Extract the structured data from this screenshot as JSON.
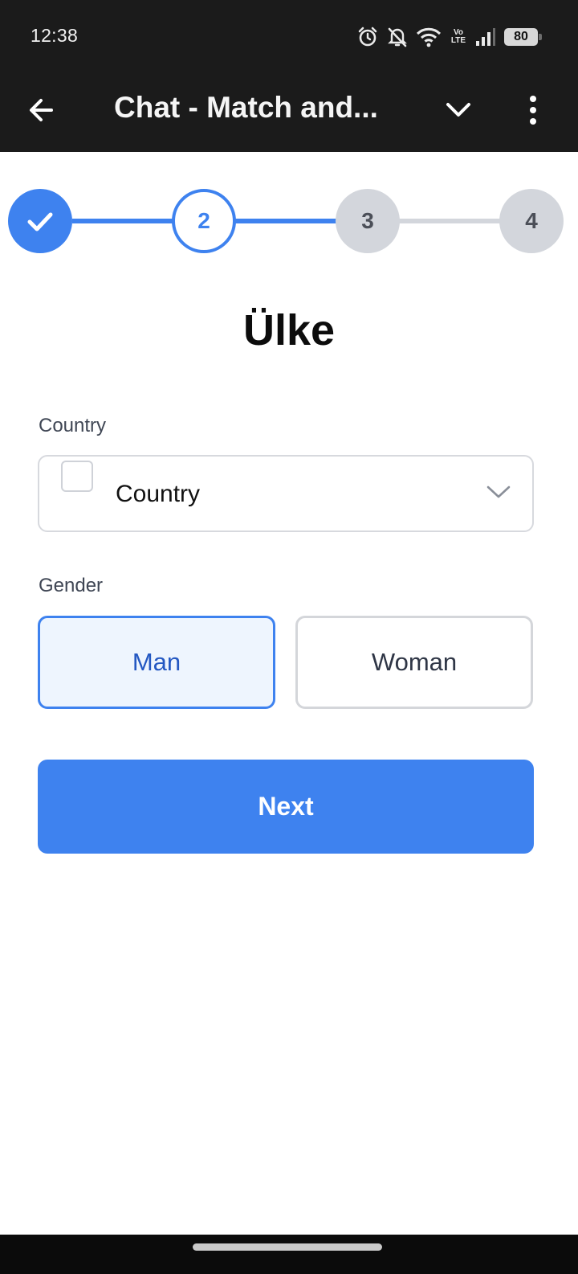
{
  "status_bar": {
    "time": "12:38",
    "volte_top": "Vo",
    "volte_bottom": "LTE",
    "battery": "80",
    "icons": [
      "alarm-icon",
      "bell-muted-icon",
      "wifi-icon",
      "volte-icon",
      "signal-icon",
      "battery-icon"
    ]
  },
  "app_bar": {
    "title": "Chat - Match and...",
    "icons": [
      "back-arrow-icon",
      "chevron-down-icon",
      "more-vert-icon"
    ]
  },
  "stepper": {
    "steps": [
      {
        "label": "",
        "state": "done",
        "icon": "check-icon"
      },
      {
        "label": "2",
        "state": "current"
      },
      {
        "label": "3",
        "state": "todo"
      },
      {
        "label": "4",
        "state": "todo"
      }
    ]
  },
  "form": {
    "title": "Ülke",
    "country_label": "Country",
    "country_value": "Country",
    "gender_label": "Gender",
    "gender_options": [
      {
        "label": "Man",
        "selected": true
      },
      {
        "label": "Woman",
        "selected": false
      }
    ],
    "next_label": "Next"
  },
  "colors": {
    "accent": "#3e82ef",
    "bar_bg": "#1b1b1b",
    "step_todo": "#d3d6dc",
    "selected_bg": "#eef5fe"
  }
}
